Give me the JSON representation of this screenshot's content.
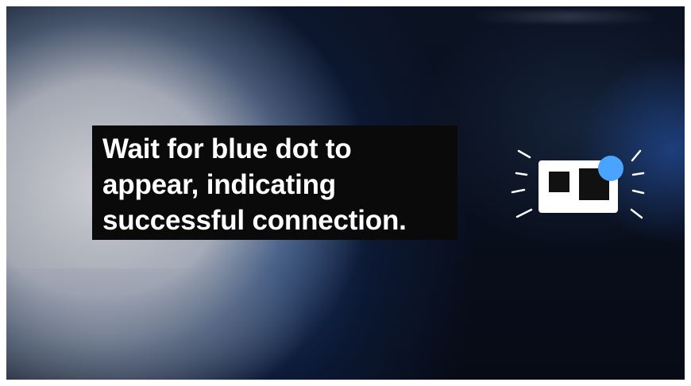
{
  "caption": {
    "lines": [
      "Wait for blue dot to",
      "appear, indicating",
      "successful connection."
    ]
  },
  "illustration": {
    "icon": "camera-connected-icon",
    "dot_color": "#4aa3ff",
    "body_color": "#ffffff",
    "lens_color": "#111111"
  }
}
